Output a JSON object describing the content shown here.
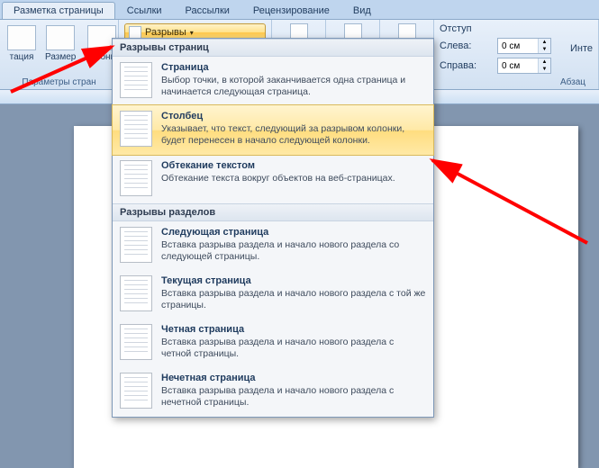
{
  "tabs": {
    "items": [
      {
        "label": "Разметка страницы",
        "active": true
      },
      {
        "label": "Ссылки"
      },
      {
        "label": "Рассылки"
      },
      {
        "label": "Рецензирование"
      },
      {
        "label": "Вид"
      }
    ]
  },
  "ribbon": {
    "orientation": "тация",
    "size": "Размер",
    "columns": "Колонки",
    "breaks_label": "Разрывы",
    "group_page": "Параметры стран",
    "indent_title": "Отступ",
    "interval_title": "Инте",
    "left_label": "Слева:",
    "right_label": "Справа:",
    "left_value": "0 см",
    "right_value": "0 см",
    "group_abzac": "Абзац"
  },
  "dropdown": {
    "section1": "Разрывы страниц",
    "section2": "Разрывы разделов",
    "items1": [
      {
        "title": "Страница",
        "desc": "Выбор точки, в которой заканчивается одна страница и начинается следующая страница."
      },
      {
        "title": "Столбец",
        "desc": "Указывает, что текст, следующий за разрывом колонки, будет перенесен в начало следующей колонки."
      },
      {
        "title": "Обтекание текстом",
        "desc": "Обтекание текста вокруг объектов на веб-страницах."
      }
    ],
    "items2": [
      {
        "title": "Следующая страница",
        "desc": "Вставка разрыва раздела и начало нового раздела со следующей страницы."
      },
      {
        "title": "Текущая страница",
        "desc": "Вставка разрыва раздела и начало нового раздела с той же страницы."
      },
      {
        "title": "Четная страница",
        "desc": "Вставка разрыва раздела и начало нового раздела с четной страницы."
      },
      {
        "title": "Нечетная страница",
        "desc": "Вставка разрыва раздела и начало нового раздела с нечетной страницы."
      }
    ]
  }
}
